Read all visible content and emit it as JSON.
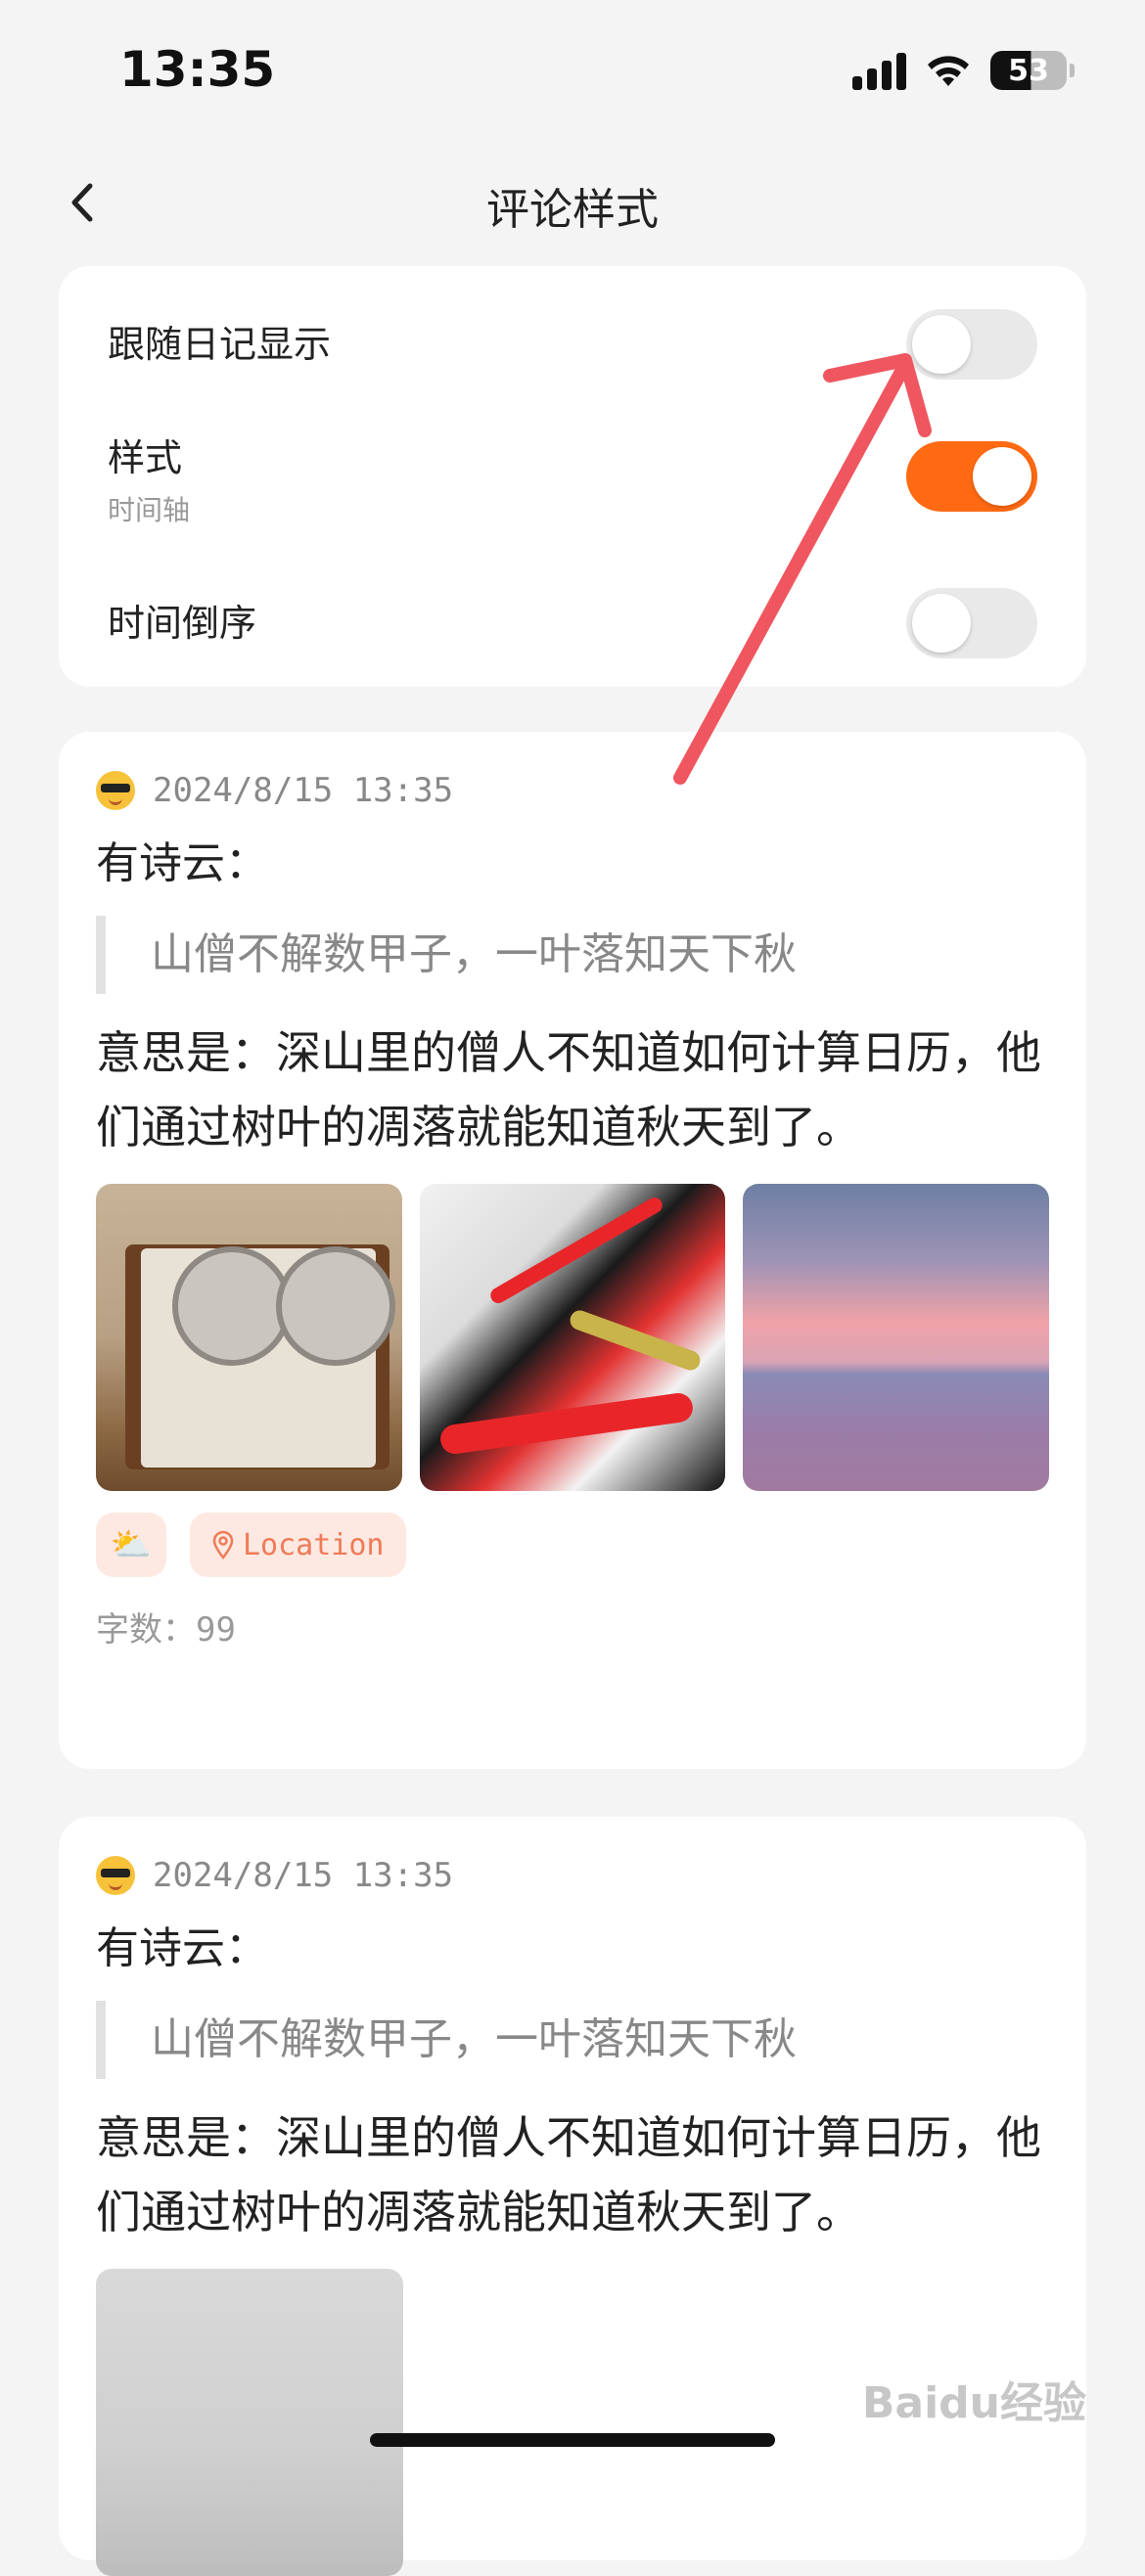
{
  "status_bar": {
    "time": "13:35",
    "battery": "53"
  },
  "nav": {
    "title": "评论样式"
  },
  "settings": {
    "follow_diary": {
      "label": "跟随日记显示",
      "on": false
    },
    "style": {
      "label": "样式",
      "sub": "时间轴",
      "on": true
    },
    "reverse_time": {
      "label": "时间倒序",
      "on": false
    }
  },
  "entries": [
    {
      "date": "2024/8/15 13:35",
      "heading": "有诗云：",
      "quote": "山僧不解数甲子，一叶落知天下秋",
      "body": "意思是：深山里的僧人不知道如何计算日历，他们通过树叶的凋落就能知道秋天到了。",
      "location": "Location",
      "word_count": "字数：99"
    },
    {
      "date": "2024/8/15 13:35",
      "heading": "有诗云：",
      "quote": "山僧不解数甲子，一叶落知天下秋",
      "body": "意思是：深山里的僧人不知道如何计算日历，他们通过树叶的凋落就能知道秋天到了。"
    }
  ],
  "watermark": "Baidu经验",
  "colors": {
    "accent": "#ff6a13",
    "annotation_arrow": "#f0565f",
    "tag_bg": "#fde9e2"
  }
}
